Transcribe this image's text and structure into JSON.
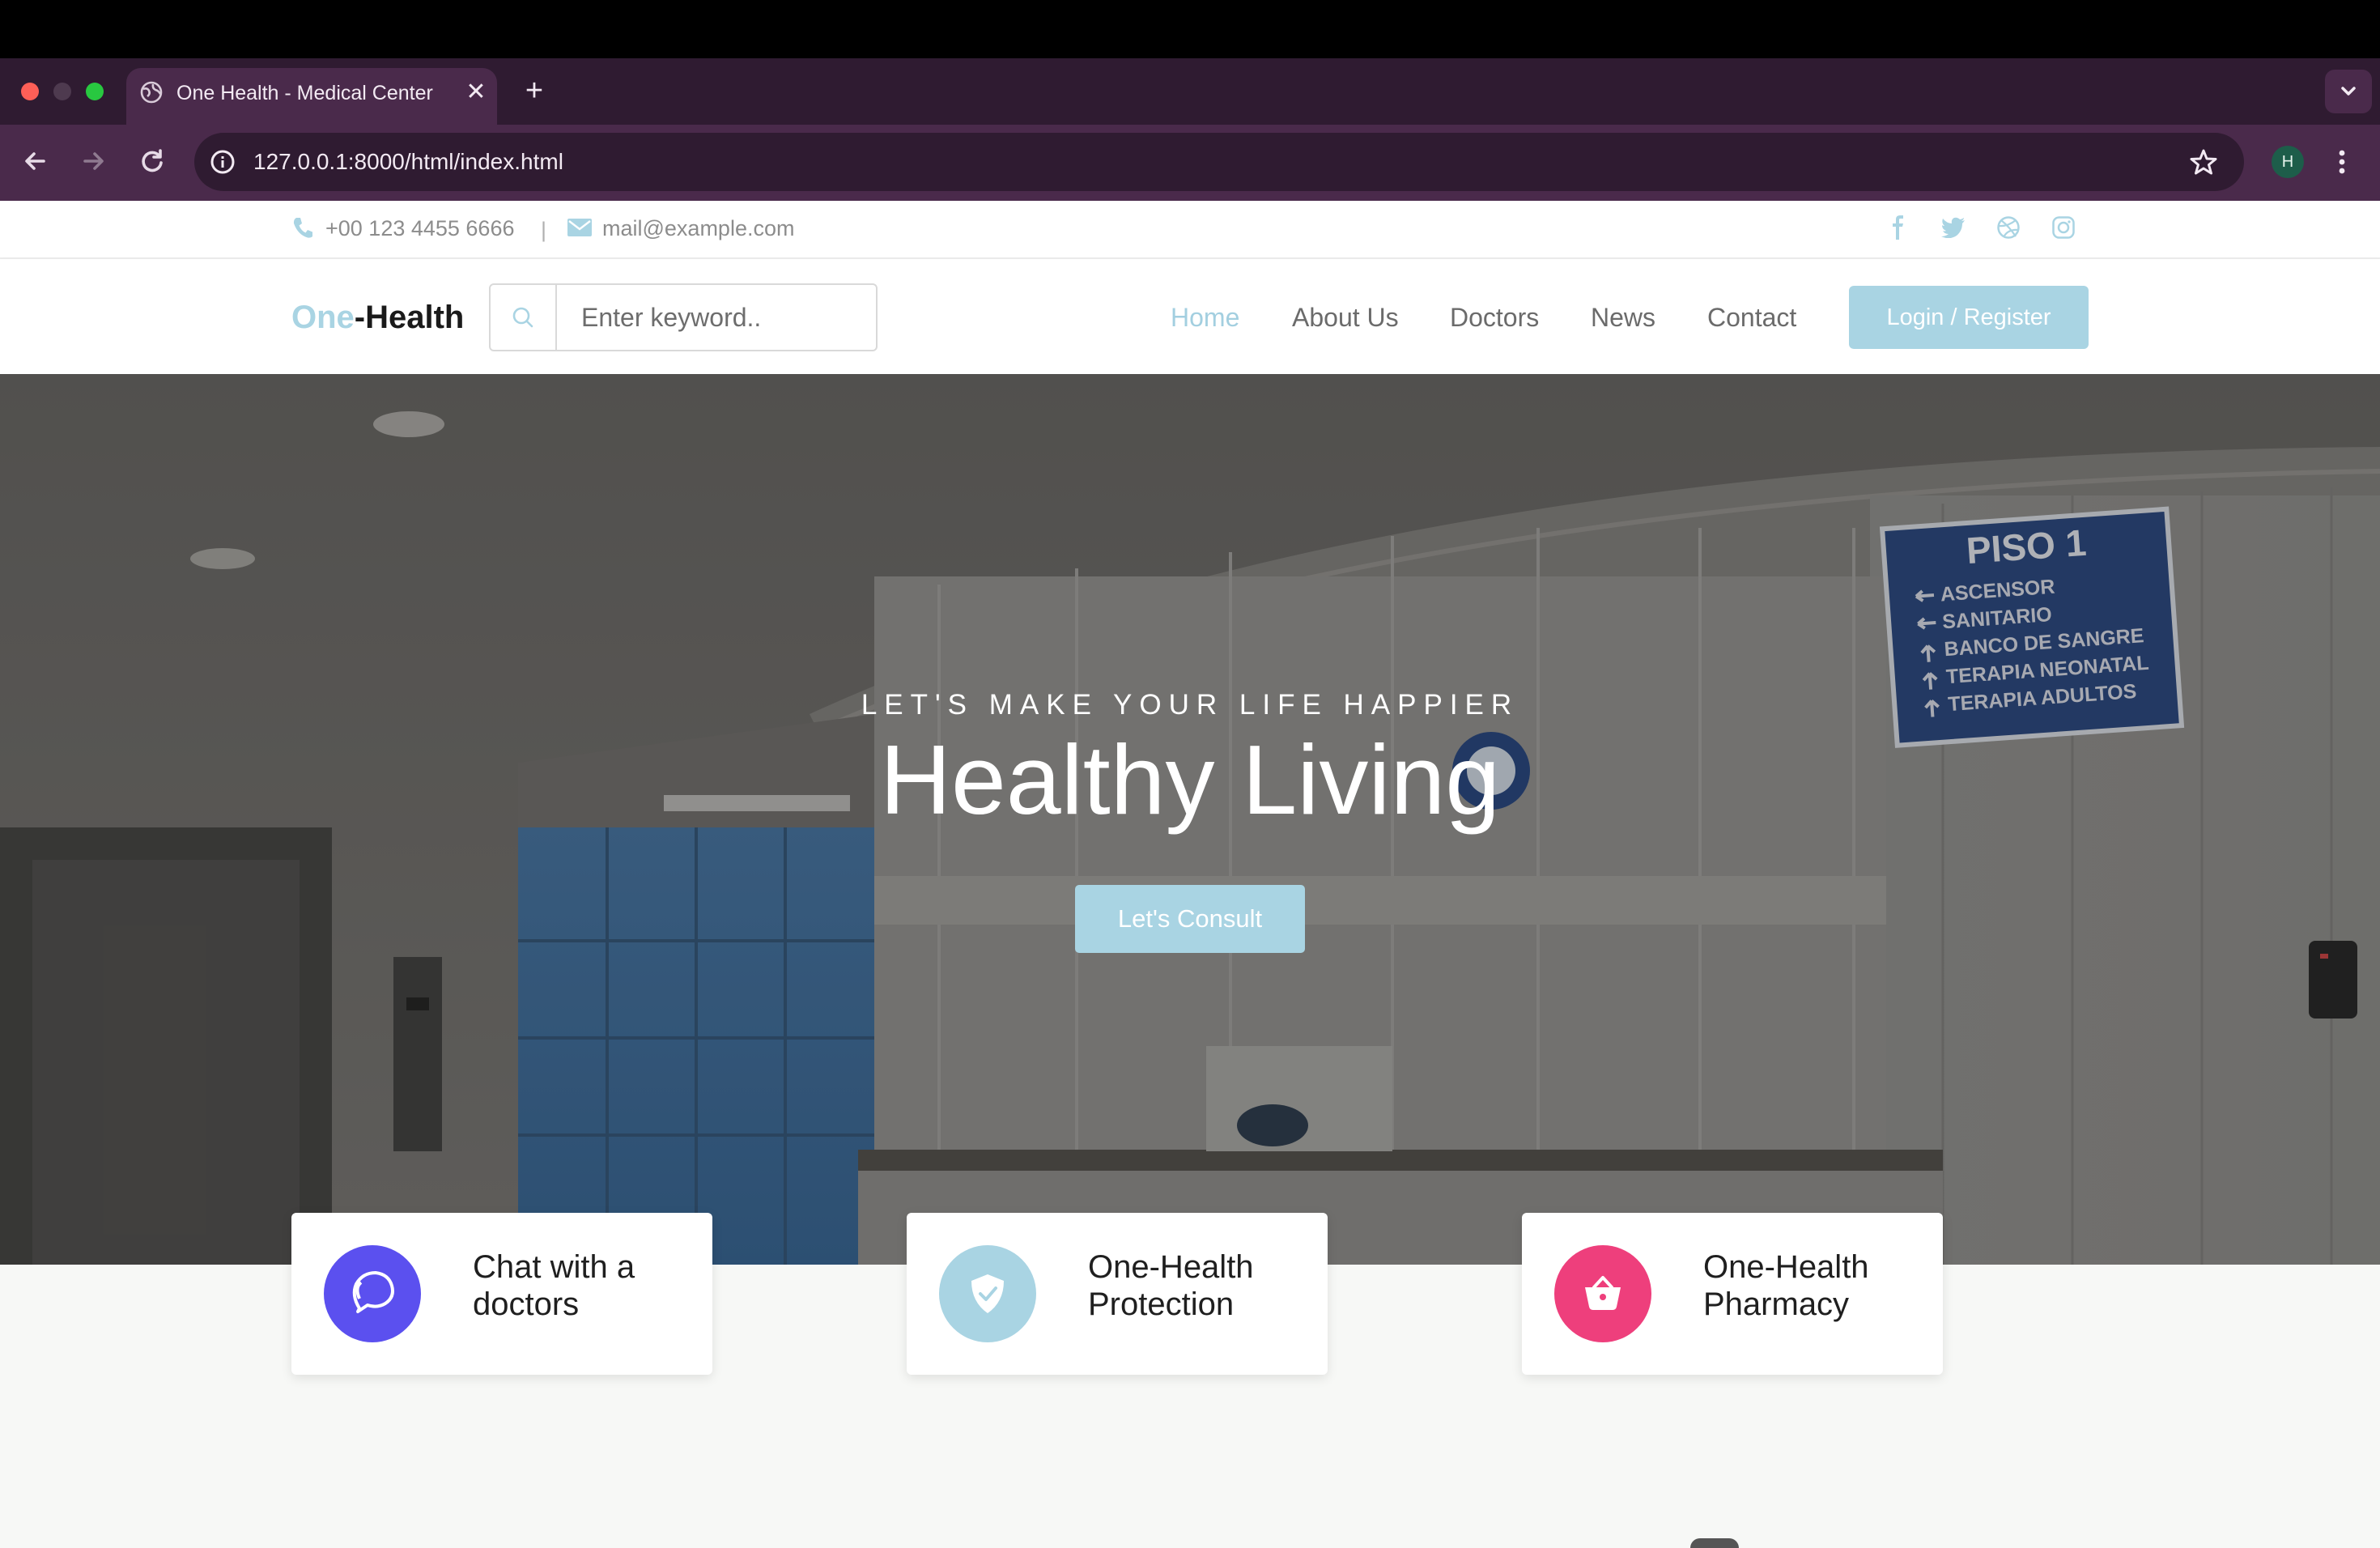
{
  "browser": {
    "tab_title": "One Health - Medical Center",
    "url": "127.0.0.1:8000/html/index.html",
    "profile_initial": "H"
  },
  "topbar": {
    "phone": "+00 123 4455 6666",
    "separator": "|",
    "email": "mail@example.com",
    "social_icons": [
      "facebook-icon",
      "twitter-icon",
      "dribbble-icon",
      "instagram-icon"
    ]
  },
  "header": {
    "logo_part1": "One",
    "logo_part2": "-Health",
    "search_placeholder": "Enter keyword..",
    "nav": [
      {
        "label": "Home",
        "active": true
      },
      {
        "label": "About Us",
        "active": false
      },
      {
        "label": "Doctors",
        "active": false
      },
      {
        "label": "News",
        "active": false
      },
      {
        "label": "Contact",
        "active": false
      }
    ],
    "login_label": "Login / Register"
  },
  "hero": {
    "subtitle": "LET'S MAKE YOUR LIFE HAPPIER",
    "title": "Healthy Living",
    "button_label": "Let's Consult",
    "sign": {
      "heading": "PISO 1",
      "lines": [
        "ASCENSOR",
        "SANITARIO",
        "BANCO DE SANGRE",
        "TERAPIA NEONATAL",
        "TERAPIA ADULTOS"
      ]
    }
  },
  "features": [
    {
      "title": "Chat with a doctors",
      "icon": "chat-icon",
      "color": "#5b50ef"
    },
    {
      "title": "One-Health Protection",
      "icon": "shield-check-icon",
      "color": "#a9d4e3"
    },
    {
      "title": "One-Health Pharmacy",
      "icon": "basket-icon",
      "color": "#ee3f7c"
    }
  ],
  "colors": {
    "accent": "#a9d4e3",
    "tab_bar": "#2f1b31",
    "toolbar": "#4a2a4b"
  }
}
